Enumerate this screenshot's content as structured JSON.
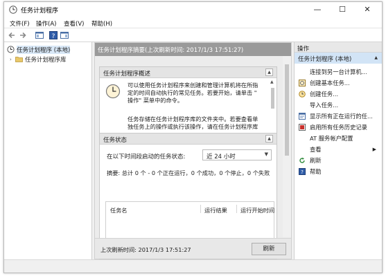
{
  "window": {
    "title": "任务计划程序",
    "controls": {
      "minimize": "—",
      "maximize": "☐",
      "close": "✕"
    }
  },
  "menu": [
    "文件(F)",
    "操作(A)",
    "查看(V)",
    "帮助(H)"
  ],
  "toolbar": {
    "buttons": [
      "back-arrow-icon",
      "forward-arrow-icon",
      "console-tree-icon",
      "help-icon",
      "show-pane-icon"
    ]
  },
  "tree": {
    "items": [
      {
        "label": "任务计划程序 (本地)",
        "icon": "clock-icon",
        "selected": true
      },
      {
        "label": "任务计划程序库",
        "icon": "folder-icon",
        "expander": "›"
      }
    ]
  },
  "center": {
    "header": "任务计划程序摘要(上次刷新时间: 2017/1/3 17:51:27)",
    "overview": {
      "title": "任务计划程序概述",
      "collapse": "▲",
      "para1": [
        "可以使用任务计划程序来创建和管理计算机将在所指",
        "定的时间自动执行的常见任务。若要开始，请单击 \"",
        "操作\" 菜单中的命令。"
      ],
      "para2": [
        "任务存储在任务计划程序库的文件夹中。若要查看单",
        "独任务上的操作或执行该操作，请在任务计划程序库"
      ]
    },
    "status": {
      "title": "任务状态",
      "collapse": "▲",
      "filter_label": "在以下时间段启动的任务状态:",
      "filter_value": "近 24 小时",
      "summary": "摘要: 总计 0 个 - 0 个正在运行，0 个成功，0 个停止，0 个失败",
      "columns": [
        "任务名",
        "运行结果",
        "运行开始时间"
      ]
    },
    "footer": {
      "last_refresh": "上次刷新时间: 2017/1/3 17:51:27",
      "refresh_button": "刷新"
    }
  },
  "actions": {
    "title": "操作",
    "section": "任务计划程序 (本地)",
    "section_arrow": "▲",
    "items": [
      {
        "label": "连接到另一台计算机...",
        "icon": ""
      },
      {
        "label": "创建基本任务...",
        "icon": "wizard-icon"
      },
      {
        "label": "创建任务...",
        "icon": "create-task-icon"
      },
      {
        "label": "导入任务...",
        "icon": ""
      },
      {
        "label": "显示所有正在运行的任...",
        "icon": "running-tasks-icon"
      },
      {
        "label": "启用所有任务历史记录",
        "icon": "history-icon"
      },
      {
        "label": "AT 服务帐户配置",
        "icon": ""
      },
      {
        "label": "查看",
        "icon": "",
        "submenu": "▶"
      },
      {
        "label": "刷新",
        "icon": "refresh-icon"
      },
      {
        "label": "帮助",
        "icon": "help-icon"
      }
    ]
  }
}
